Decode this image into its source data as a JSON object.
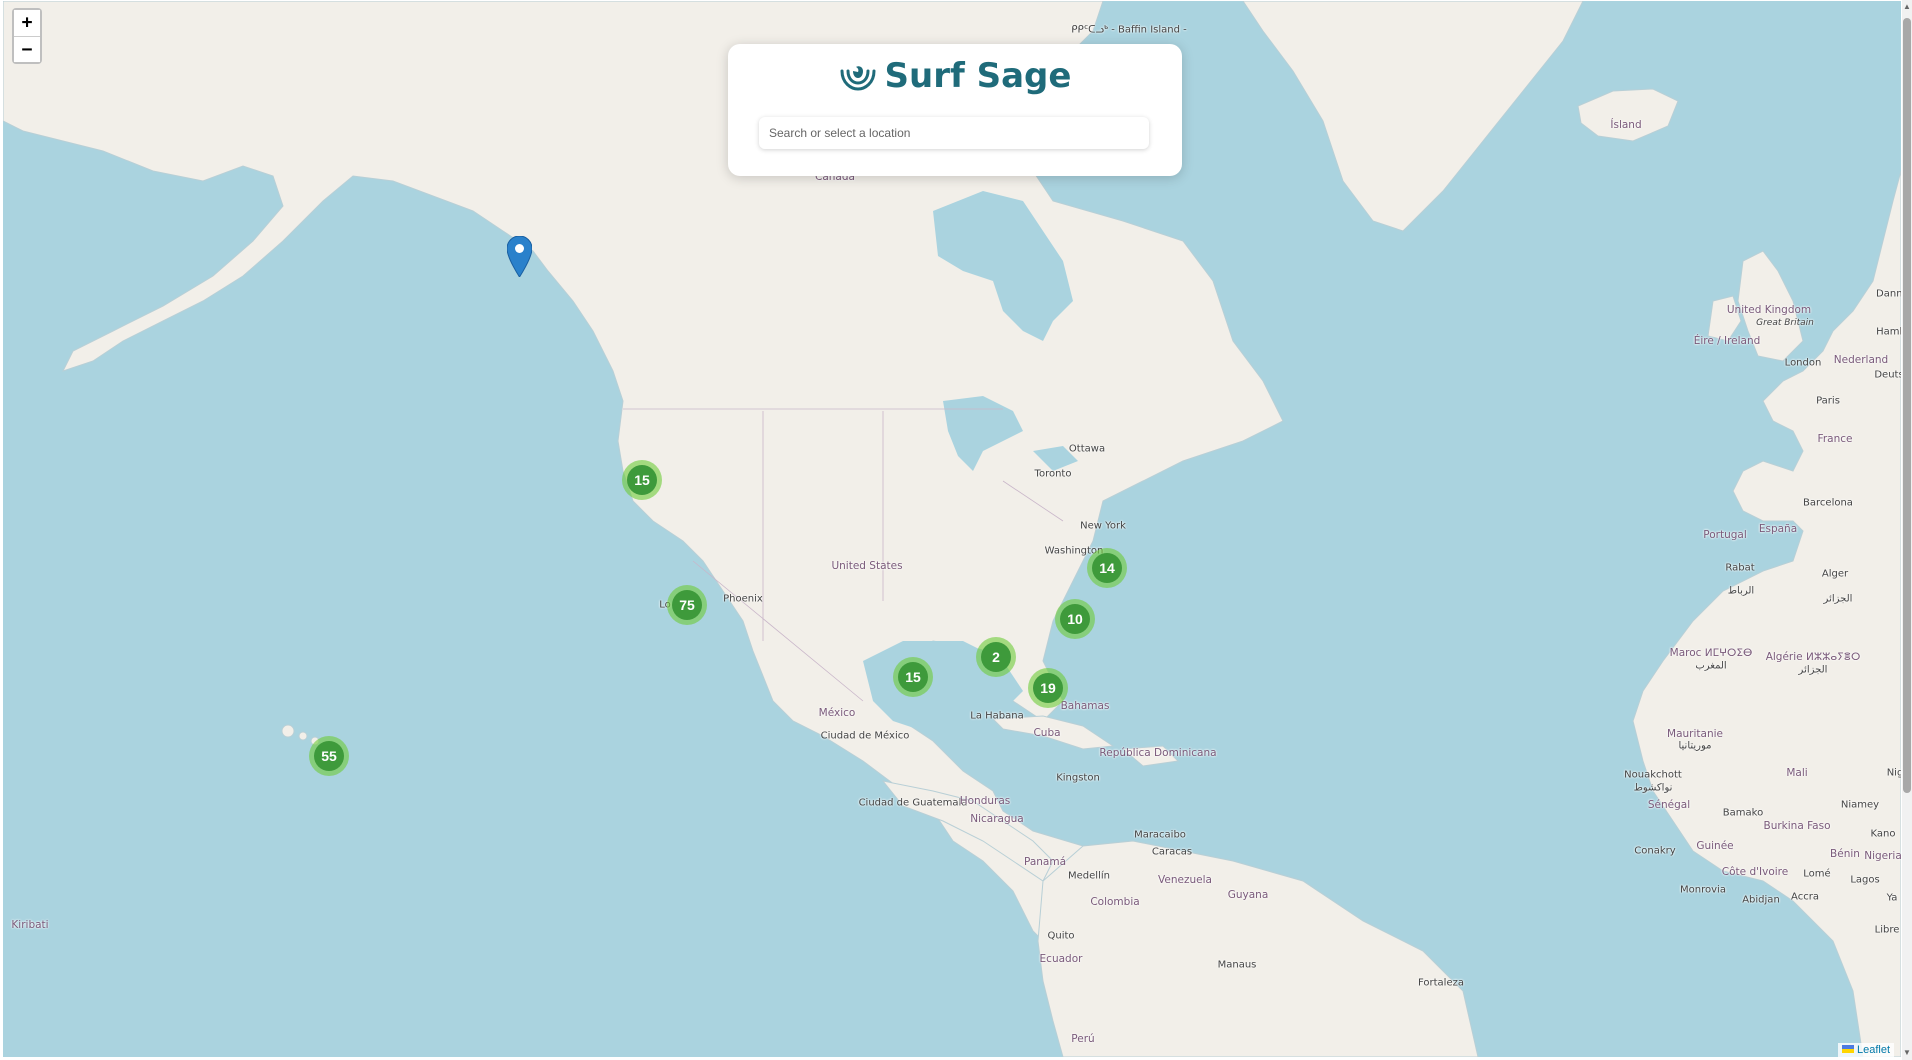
{
  "app": {
    "title": "Surf Sage",
    "logo_icon": "wave-icon",
    "accent_color": "#1f6b7a"
  },
  "search": {
    "placeholder": "Search or select a location",
    "value": ""
  },
  "zoom_controls": {
    "zoom_in_label": "+",
    "zoom_out_label": "−"
  },
  "attribution": {
    "label": "Leaflet",
    "flag_icon": "ukraine-flag-icon"
  },
  "clusters": [
    {
      "count": "15",
      "region": "Northern California coast"
    },
    {
      "count": "75",
      "region": "Southern California coast"
    },
    {
      "count": "55",
      "region": "Hawaii"
    },
    {
      "count": "15",
      "region": "Texas Gulf coast"
    },
    {
      "count": "2",
      "region": "Florida panhandle"
    },
    {
      "count": "19",
      "region": "South Florida"
    },
    {
      "count": "10",
      "region": "Georgia / Carolinas coast"
    },
    {
      "count": "14",
      "region": "North Carolina coast"
    }
  ],
  "markers": [
    {
      "type": "location-pin-icon",
      "region": "Southeast Alaska"
    }
  ],
  "map_labels": {
    "baffin": "ᑭᑭᑦᑕᓗᒃ - Baffin Island -",
    "canada": "Canada",
    "island": "Ísland",
    "united_kingdom": "United Kingdom",
    "great_britain": "Great Britain",
    "eire": "Éire / Ireland",
    "london": "London",
    "nederland": "Nederland",
    "paris": "Paris",
    "france": "France",
    "barcelona": "Barcelona",
    "espana": "España",
    "portugal": "Portugal",
    "rabat": "Rabat",
    "rabat_ar": "الرباط",
    "alger": "Alger",
    "alger_ar": "الجزائر",
    "maroc": "Maroc ⵍⵎⵖⵔⵉⴱ",
    "maroc_ar": "المغرب",
    "algerie": "Algérie ⵍⵣⵣⴰⵢⴻⵔ",
    "algerie_ar": "الجزائر",
    "mauritanie": "Mauritanie",
    "mauritanie_ar": "موريتانيا",
    "nouakchott": "Nouakchott",
    "nouakchott_ar": "نواكشوط",
    "mali": "Mali",
    "niamey": "Niamey",
    "senegal": "Sénégal",
    "bamako": "Bamako",
    "burkina": "Burkina Faso",
    "conakry": "Conakry",
    "guinee": "Guinée",
    "benin": "Bénin",
    "nigeria": "Nigeria",
    "kano": "Kano",
    "cote": "Côte d'Ivoire",
    "lome": "Lomé",
    "lagos": "Lagos",
    "monrovia": "Monrovia",
    "abidjan": "Abidjan",
    "accra": "Accra",
    "ottawa": "Ottawa",
    "toronto": "Toronto",
    "new_york": "New York",
    "washington": "Washington",
    "united_states": "United States",
    "phoenix": "Phoenix",
    "los_angeles": "Lo",
    "mexico": "México",
    "ciudad_mexico": "Ciudad de México",
    "la_habana": "La Habana",
    "cuba": "Cuba",
    "bahamas": "Bahamas",
    "republica_dominicana": "República Dominicana",
    "kingston": "Kingston",
    "guatemala": "Ciudad de Guatemala",
    "honduras": "Honduras",
    "nicaragua": "Nicaragua",
    "panama": "Panamá",
    "maracaibo": "Maracaibo",
    "caracas": "Caracas",
    "venezuela": "Venezuela",
    "medellin": "Medellín",
    "colombia": "Colombia",
    "guyana": "Guyana",
    "quito": "Quito",
    "ecuador": "Ecuador",
    "manaus": "Manaus",
    "fortaleza": "Fortaleza",
    "peru": "Perú",
    "kiribati": "Kiribati",
    "deutschland": "Deuts",
    "danmark": "Danm",
    "hamburg": "Hamb",
    "liberia": "Libre",
    "nigeria_edge": "Nig",
    "ghana_edge": "Ya"
  }
}
